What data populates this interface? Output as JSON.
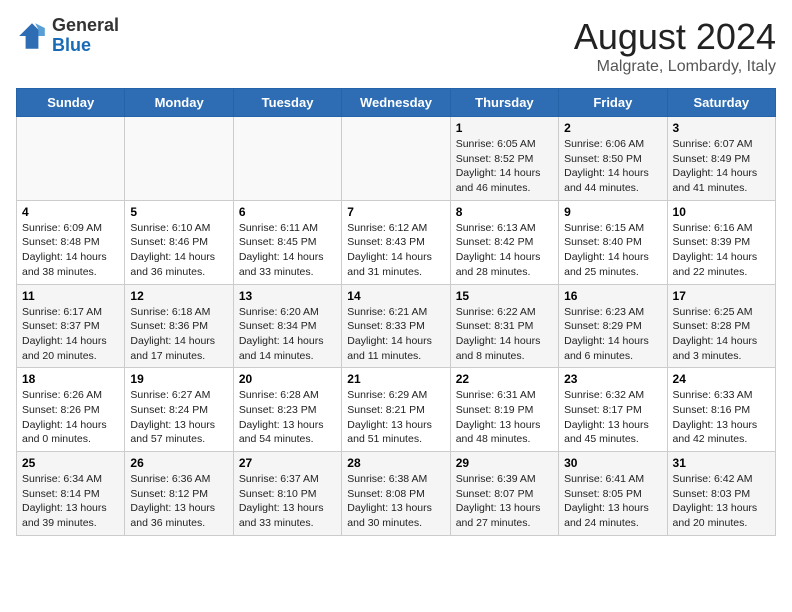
{
  "header": {
    "logo_general": "General",
    "logo_blue": "Blue",
    "month_title": "August 2024",
    "location": "Malgrate, Lombardy, Italy"
  },
  "weekdays": [
    "Sunday",
    "Monday",
    "Tuesday",
    "Wednesday",
    "Thursday",
    "Friday",
    "Saturday"
  ],
  "weeks": [
    [
      {
        "day": "",
        "info": ""
      },
      {
        "day": "",
        "info": ""
      },
      {
        "day": "",
        "info": ""
      },
      {
        "day": "",
        "info": ""
      },
      {
        "day": "1",
        "info": "Sunrise: 6:05 AM\nSunset: 8:52 PM\nDaylight: 14 hours\nand 46 minutes."
      },
      {
        "day": "2",
        "info": "Sunrise: 6:06 AM\nSunset: 8:50 PM\nDaylight: 14 hours\nand 44 minutes."
      },
      {
        "day": "3",
        "info": "Sunrise: 6:07 AM\nSunset: 8:49 PM\nDaylight: 14 hours\nand 41 minutes."
      }
    ],
    [
      {
        "day": "4",
        "info": "Sunrise: 6:09 AM\nSunset: 8:48 PM\nDaylight: 14 hours\nand 38 minutes."
      },
      {
        "day": "5",
        "info": "Sunrise: 6:10 AM\nSunset: 8:46 PM\nDaylight: 14 hours\nand 36 minutes."
      },
      {
        "day": "6",
        "info": "Sunrise: 6:11 AM\nSunset: 8:45 PM\nDaylight: 14 hours\nand 33 minutes."
      },
      {
        "day": "7",
        "info": "Sunrise: 6:12 AM\nSunset: 8:43 PM\nDaylight: 14 hours\nand 31 minutes."
      },
      {
        "day": "8",
        "info": "Sunrise: 6:13 AM\nSunset: 8:42 PM\nDaylight: 14 hours\nand 28 minutes."
      },
      {
        "day": "9",
        "info": "Sunrise: 6:15 AM\nSunset: 8:40 PM\nDaylight: 14 hours\nand 25 minutes."
      },
      {
        "day": "10",
        "info": "Sunrise: 6:16 AM\nSunset: 8:39 PM\nDaylight: 14 hours\nand 22 minutes."
      }
    ],
    [
      {
        "day": "11",
        "info": "Sunrise: 6:17 AM\nSunset: 8:37 PM\nDaylight: 14 hours\nand 20 minutes."
      },
      {
        "day": "12",
        "info": "Sunrise: 6:18 AM\nSunset: 8:36 PM\nDaylight: 14 hours\nand 17 minutes."
      },
      {
        "day": "13",
        "info": "Sunrise: 6:20 AM\nSunset: 8:34 PM\nDaylight: 14 hours\nand 14 minutes."
      },
      {
        "day": "14",
        "info": "Sunrise: 6:21 AM\nSunset: 8:33 PM\nDaylight: 14 hours\nand 11 minutes."
      },
      {
        "day": "15",
        "info": "Sunrise: 6:22 AM\nSunset: 8:31 PM\nDaylight: 14 hours\nand 8 minutes."
      },
      {
        "day": "16",
        "info": "Sunrise: 6:23 AM\nSunset: 8:29 PM\nDaylight: 14 hours\nand 6 minutes."
      },
      {
        "day": "17",
        "info": "Sunrise: 6:25 AM\nSunset: 8:28 PM\nDaylight: 14 hours\nand 3 minutes."
      }
    ],
    [
      {
        "day": "18",
        "info": "Sunrise: 6:26 AM\nSunset: 8:26 PM\nDaylight: 14 hours\nand 0 minutes."
      },
      {
        "day": "19",
        "info": "Sunrise: 6:27 AM\nSunset: 8:24 PM\nDaylight: 13 hours\nand 57 minutes."
      },
      {
        "day": "20",
        "info": "Sunrise: 6:28 AM\nSunset: 8:23 PM\nDaylight: 13 hours\nand 54 minutes."
      },
      {
        "day": "21",
        "info": "Sunrise: 6:29 AM\nSunset: 8:21 PM\nDaylight: 13 hours\nand 51 minutes."
      },
      {
        "day": "22",
        "info": "Sunrise: 6:31 AM\nSunset: 8:19 PM\nDaylight: 13 hours\nand 48 minutes."
      },
      {
        "day": "23",
        "info": "Sunrise: 6:32 AM\nSunset: 8:17 PM\nDaylight: 13 hours\nand 45 minutes."
      },
      {
        "day": "24",
        "info": "Sunrise: 6:33 AM\nSunset: 8:16 PM\nDaylight: 13 hours\nand 42 minutes."
      }
    ],
    [
      {
        "day": "25",
        "info": "Sunrise: 6:34 AM\nSunset: 8:14 PM\nDaylight: 13 hours\nand 39 minutes."
      },
      {
        "day": "26",
        "info": "Sunrise: 6:36 AM\nSunset: 8:12 PM\nDaylight: 13 hours\nand 36 minutes."
      },
      {
        "day": "27",
        "info": "Sunrise: 6:37 AM\nSunset: 8:10 PM\nDaylight: 13 hours\nand 33 minutes."
      },
      {
        "day": "28",
        "info": "Sunrise: 6:38 AM\nSunset: 8:08 PM\nDaylight: 13 hours\nand 30 minutes."
      },
      {
        "day": "29",
        "info": "Sunrise: 6:39 AM\nSunset: 8:07 PM\nDaylight: 13 hours\nand 27 minutes."
      },
      {
        "day": "30",
        "info": "Sunrise: 6:41 AM\nSunset: 8:05 PM\nDaylight: 13 hours\nand 24 minutes."
      },
      {
        "day": "31",
        "info": "Sunrise: 6:42 AM\nSunset: 8:03 PM\nDaylight: 13 hours\nand 20 minutes."
      }
    ]
  ]
}
